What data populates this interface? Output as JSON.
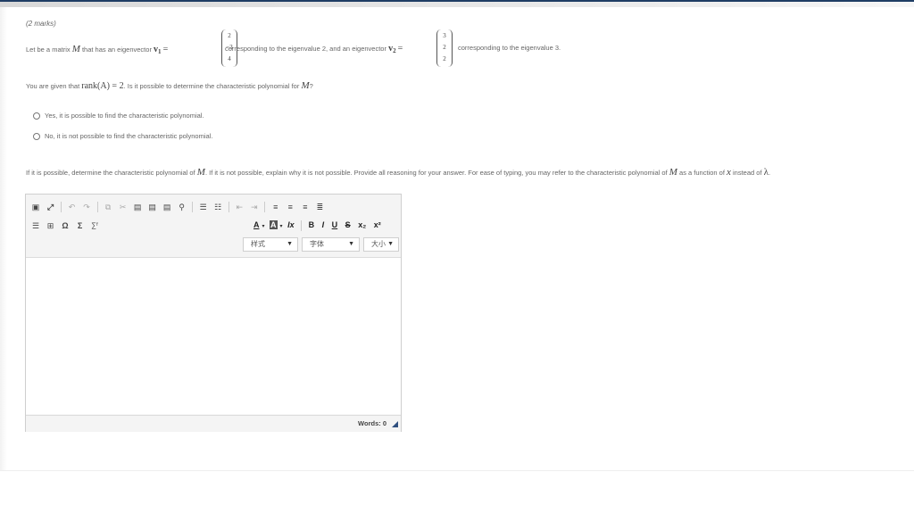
{
  "question": {
    "marks": "(2 marks)",
    "line1": {
      "prefix": "Let be a matrix",
      "matrix_symbol": "M",
      "middle1": "that has an eigenvector",
      "v1_name": "v",
      "v1_sub": "1",
      "equals": "=",
      "v1_entries": [
        "2",
        "−3",
        "4"
      ],
      "after_v1": "corresponding to the eigenvalue 2, and an eigenvector",
      "v2_name": "v",
      "v2_sub": "2",
      "v2_entries": [
        "3",
        "2",
        "2"
      ],
      "after_v2": "corresponding to the eigenvalue 3."
    },
    "line2": {
      "prefix": "You are given that",
      "rank_expr": "rank(A) = 2",
      "suffix": ". Is it possible to determine the characteristic polynomial for",
      "symbol": "M",
      "end": "?"
    },
    "options": [
      {
        "label": "Yes, it is possible to find the characteristic polynomial.",
        "selected": false
      },
      {
        "label": "No, it is not possible to find the characteristic polynomial.",
        "selected": false
      }
    ],
    "line3": {
      "text1": "If it is possible, determine the characteristic polynomial of",
      "symbol1": "M",
      "text2": ". If it is not possible, explain why it is not possible. Provide all reasoning for your answer. For ease of typing, you may refer to the characteristic polynomial of",
      "symbol2": "M",
      "text3": "as a function of",
      "symbol3": "x",
      "text4": "instead of",
      "symbol4": "λ",
      "end": "."
    }
  },
  "editor": {
    "toolbar_row1": [
      "source-icon",
      "maximize-icon",
      "undo-icon",
      "redo-icon",
      "copy-icon",
      "cut-icon",
      "paste-icon",
      "paste-text-icon",
      "paste-word-icon",
      "find-icon",
      "numbered-list-icon",
      "bulleted-list-icon",
      "outdent-icon",
      "indent-icon",
      "align-left-icon",
      "align-center-icon",
      "align-right-icon",
      "justify-icon"
    ],
    "toolbar_row2": [
      "horizontal-rule-icon",
      "table-icon",
      "omega-icon",
      "sigma-icon",
      "formula-icon"
    ],
    "format_buttons": [
      "A",
      "A",
      "Ix",
      "B",
      "I",
      "U",
      "S",
      "x₂",
      "x²"
    ],
    "style_label": "样式",
    "font_label": "字体",
    "size_label": "大小",
    "words_label": "Words: 0"
  },
  "colors": {
    "accent": "#1f3d64",
    "text": "#666666"
  }
}
